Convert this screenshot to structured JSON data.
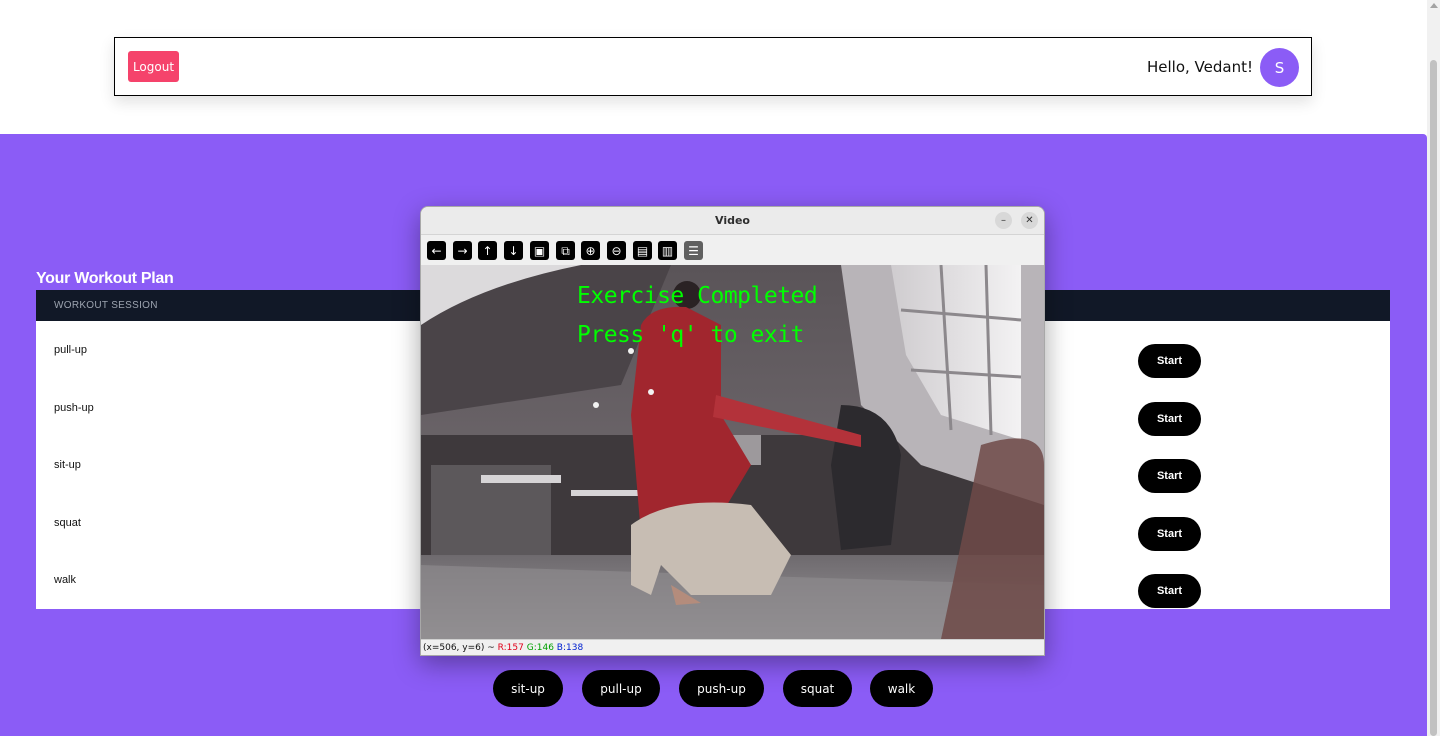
{
  "header": {
    "logout_label": "Logout",
    "greeting": "Hello, Vedant!",
    "avatar_initial": "S"
  },
  "plan": {
    "title": "Your Workout Plan",
    "column_header": "WORKOUT SESSION",
    "rows": [
      {
        "name": "pull-up",
        "action": "Start"
      },
      {
        "name": "push-up",
        "action": "Start"
      },
      {
        "name": "sit-up",
        "action": "Start"
      },
      {
        "name": "squat",
        "action": "Start"
      },
      {
        "name": "walk",
        "action": "Start"
      }
    ]
  },
  "exercise_buttons": [
    "sit-up",
    "pull-up",
    "push-up",
    "squat",
    "walk"
  ],
  "video_window": {
    "title": "Video",
    "minimize_glyph": "–",
    "close_glyph": "✕",
    "toolbar_icons": [
      {
        "icon": "arrow-left-icon",
        "glyph": "←"
      },
      {
        "icon": "arrow-right-icon",
        "glyph": "→"
      },
      {
        "icon": "arrow-up-icon",
        "glyph": "↑"
      },
      {
        "icon": "arrow-down-icon",
        "glyph": "↓"
      },
      {
        "icon": "zoom-fit-icon",
        "glyph": "▣"
      },
      {
        "icon": "zoom-original-icon",
        "glyph": "⧉"
      },
      {
        "icon": "zoom-in-icon",
        "glyph": "⊕"
      },
      {
        "icon": "zoom-out-icon",
        "glyph": "⊖"
      },
      {
        "icon": "save-icon",
        "glyph": "▤"
      },
      {
        "icon": "copy-clipboard-icon",
        "glyph": "▥"
      },
      {
        "icon": "properties-icon",
        "glyph": "☰"
      }
    ],
    "overlay_line_1": "Exercise Completed",
    "overlay_line_2": "Press 'q' to exit",
    "status_coords": "(x=506, y=6) ~",
    "status_r": "R:157",
    "status_g": "G:146",
    "status_b": "B:138"
  },
  "colors": {
    "purple": "#8b5cf6",
    "logout": "#f5436b",
    "table_header": "#111827",
    "overlay_text": "#00ff00"
  }
}
